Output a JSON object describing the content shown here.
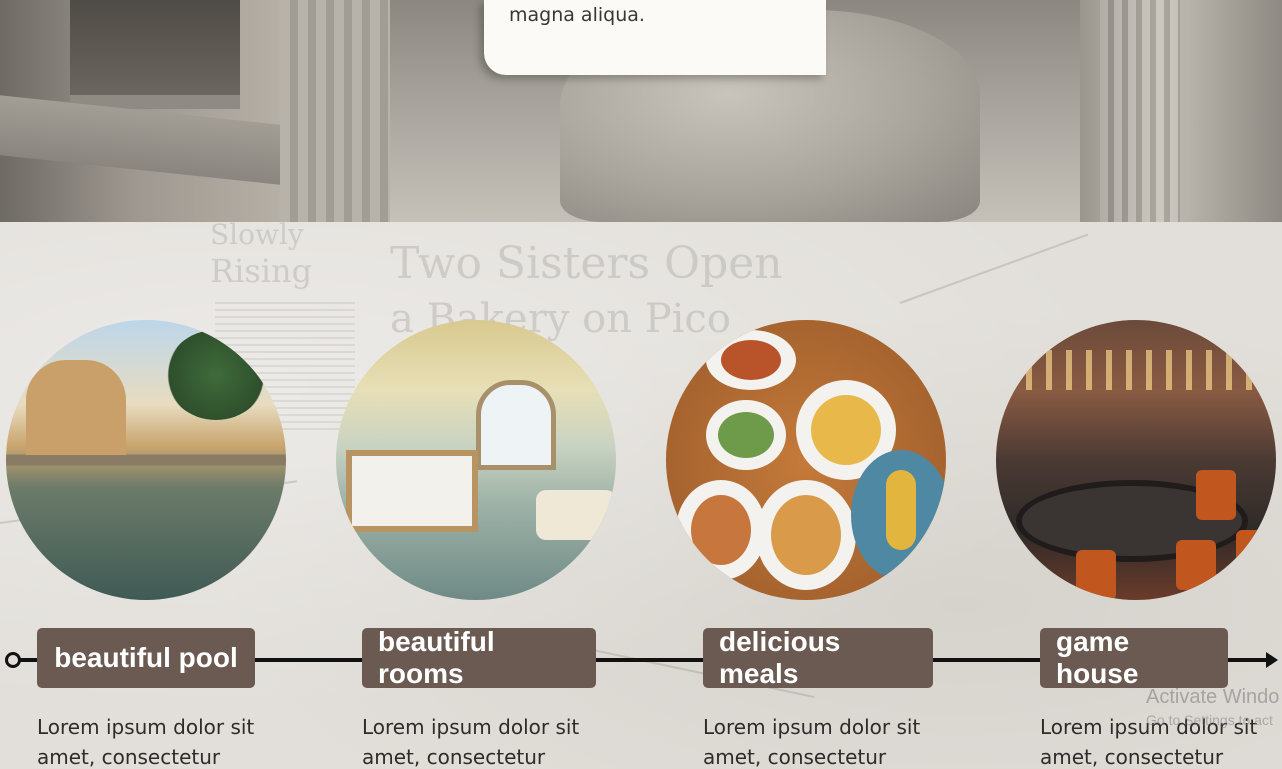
{
  "hero": {
    "paper_text": "magna aliqua."
  },
  "background_newspaper": {
    "headline_1": "Two Sisters Open",
    "headline_2": "a Bakery on Pico",
    "headline_3": "Slowly",
    "headline_4": "Rising"
  },
  "timeline": {
    "items": [
      {
        "title": "beautiful pool",
        "description": "Lorem ipsum dolor sit amet, consectetur",
        "image": "pool-photo"
      },
      {
        "title": "beautiful rooms",
        "description": "Lorem ipsum dolor sit amet, consectetur",
        "image": "room-photo"
      },
      {
        "title": "delicious meals",
        "description": "Lorem ipsum dolor sit amet, consectetur",
        "image": "meals-photo"
      },
      {
        "title": "game house",
        "description": "Lorem ipsum dolor sit amet, consectetur",
        "image": "casino-photo"
      }
    ]
  },
  "watermark": {
    "title": "Activate Windo",
    "subtitle": "Go to Settings to act"
  },
  "colors": {
    "label_bg": "#6a5a51",
    "label_text": "#ffffff",
    "timeline_line": "#111111"
  }
}
